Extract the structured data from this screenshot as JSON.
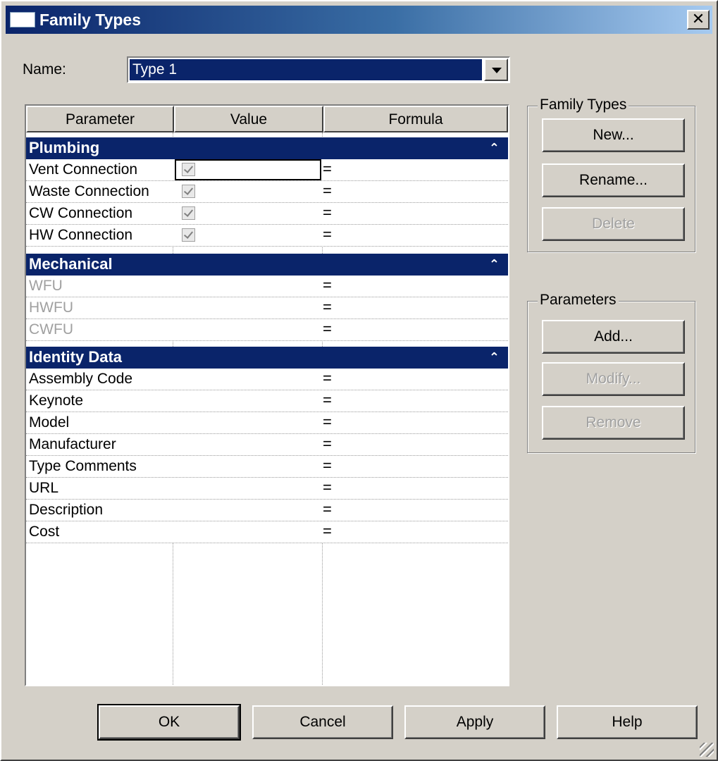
{
  "window": {
    "title": "Family Types",
    "close_label": "✕"
  },
  "name_field": {
    "label": "Name:",
    "value": "Type 1"
  },
  "grid": {
    "columns": [
      "Parameter",
      "Value",
      "Formula"
    ],
    "groups": [
      {
        "title": "Plumbing",
        "collapse_glyph": "⌃",
        "rows": [
          {
            "name": "Vent Connection",
            "checked": true,
            "formula": "="
          },
          {
            "name": "Waste Connection",
            "checked": true,
            "formula": "="
          },
          {
            "name": "CW Connection",
            "checked": true,
            "formula": "="
          },
          {
            "name": "HW Connection",
            "checked": true,
            "formula": "="
          }
        ]
      },
      {
        "title": "Mechanical",
        "collapse_glyph": "⌃",
        "rows": [
          {
            "name": "WFU",
            "formula": "="
          },
          {
            "name": "HWFU",
            "formula": "="
          },
          {
            "name": "CWFU",
            "formula": "="
          }
        ]
      },
      {
        "title": "Identity Data",
        "collapse_glyph": "⌃",
        "rows": [
          {
            "name": "Assembly Code",
            "formula": "="
          },
          {
            "name": "Keynote",
            "formula": "="
          },
          {
            "name": "Model",
            "formula": "="
          },
          {
            "name": "Manufacturer",
            "formula": "="
          },
          {
            "name": "Type Comments",
            "formula": "="
          },
          {
            "name": "URL",
            "formula": "="
          },
          {
            "name": "Description",
            "formula": "="
          },
          {
            "name": "Cost",
            "formula": "="
          }
        ]
      }
    ]
  },
  "family_types_panel": {
    "label": "Family Types",
    "new": "New...",
    "rename": "Rename...",
    "delete": "Delete"
  },
  "parameters_panel": {
    "label": "Parameters",
    "add": "Add...",
    "modify": "Modify...",
    "remove": "Remove"
  },
  "footer": {
    "ok": "OK",
    "cancel": "Cancel",
    "apply": "Apply",
    "help": "Help"
  }
}
